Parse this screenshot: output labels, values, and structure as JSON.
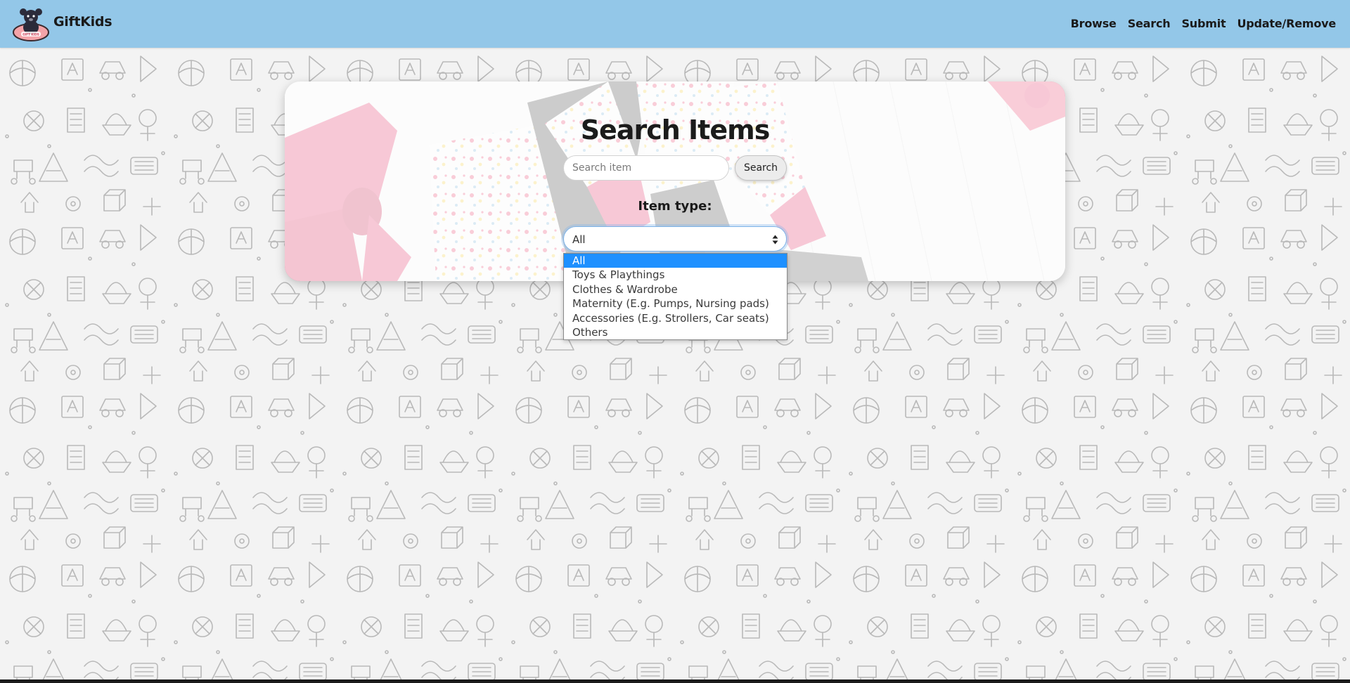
{
  "brand": {
    "name": "GiftKids",
    "logo_badge_text": "GIFT KIDS"
  },
  "nav": {
    "links": [
      "Browse",
      "Search",
      "Submit",
      "Update/Remove"
    ]
  },
  "search": {
    "title": "Search Items",
    "input_placeholder": "Search item",
    "input_value": "",
    "button_label": "Search"
  },
  "filter": {
    "label": "Item type:",
    "selected": "All",
    "options": [
      "All",
      "Toys & Playthings",
      "Clothes & Wardrobe",
      "Maternity (E.g. Pumps, Nursing pads)",
      "Accessories (E.g. Strollers, Car seats)",
      "Others"
    ],
    "highlighted_index": 0
  },
  "colors": {
    "navbar": "#93c7e8",
    "page_background": "#f3f3f3",
    "doodle_stroke": "#b9b9b9",
    "select_focus": "#7eb4ea",
    "option_highlight": "#1e90ff",
    "card_accent_pink": "#e03a6c"
  },
  "icons": {
    "logo": "teddy-bear-logo",
    "select_arrow": "sort-updown-icon",
    "background": "toy-doodle-pattern"
  }
}
